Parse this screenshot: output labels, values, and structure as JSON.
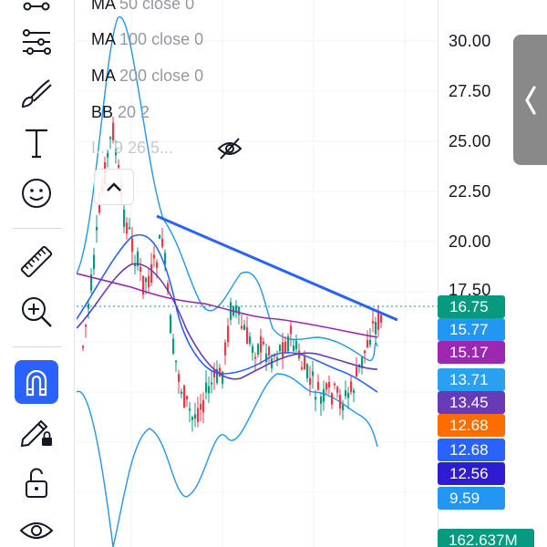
{
  "toolbar": {
    "tools": [
      {
        "name": "connections-tool",
        "icon": "connections-icon"
      },
      {
        "name": "line-tool",
        "icon": "settings-sliders-icon"
      },
      {
        "name": "brush-tool",
        "icon": "brush-icon"
      },
      {
        "name": "text-tool",
        "icon": "text-icon"
      },
      {
        "name": "emoji-tool",
        "icon": "smiley-icon"
      },
      {
        "name": "ruler-tool",
        "icon": "ruler-icon"
      },
      {
        "name": "zoom-tool",
        "icon": "zoom-in-icon"
      },
      {
        "name": "magnet-tool",
        "icon": "magnet-icon",
        "active": true
      },
      {
        "name": "lock-drawing-tool",
        "icon": "pencil-lock-icon"
      },
      {
        "name": "lock-tool",
        "icon": "unlock-icon"
      },
      {
        "name": "visibility-tool",
        "icon": "eye-icon"
      }
    ],
    "active_color": "#2962ff"
  },
  "legend": {
    "rows": [
      {
        "label": "MA",
        "value": "50 close 0"
      },
      {
        "label": "MA",
        "value": "100 close 0"
      },
      {
        "label": "MA",
        "value": "200 close 0"
      },
      {
        "label": "BB",
        "value": "20 2"
      }
    ],
    "hidden_row": "I... 9 26 5...",
    "hidden_icon": "eye-off-icon",
    "collapse_icon": "chevron-up-icon"
  },
  "price_axis": {
    "ticks": [
      "30.00",
      "27.50",
      "25.00",
      "22.50",
      "20.00",
      "17.50"
    ],
    "tags": [
      {
        "text": "16.75",
        "color": "#089981"
      },
      {
        "text": "15.77",
        "color": "#2196f3"
      },
      {
        "text": "15.17",
        "color": "#9c27b0"
      },
      {
        "text": "13.71",
        "color": "#29a0f0"
      },
      {
        "text": "13.45",
        "color": "#673ab7"
      },
      {
        "text": "12.68",
        "color": "#ff6d00"
      },
      {
        "text": "12.68",
        "color": "#2962ff"
      },
      {
        "text": "12.56",
        "color": "#311bd2"
      },
      {
        "text": "9.59",
        "color": "#2196f3"
      }
    ],
    "volume_tag": {
      "text": "162.637M",
      "color": "#089981"
    }
  },
  "side_handle": {
    "icon": "chevron-left-icon"
  },
  "colors": {
    "up": "#089981",
    "down": "#f23645",
    "trendline": "#2962ff",
    "bb_band": "#2196f3",
    "bb_fill": "#e3f2fd",
    "ma50": "#2962ff",
    "ma100": "#673ab7",
    "ma200": "#9c27b0",
    "last_price_line": "#089981"
  }
}
